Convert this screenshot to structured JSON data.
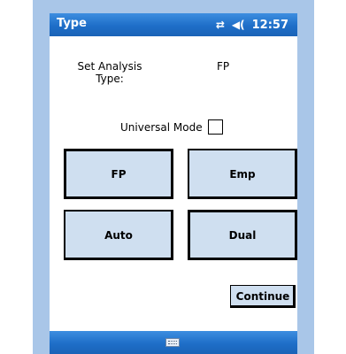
{
  "title_bar": {
    "title": "Type",
    "time": "12:57",
    "icons": [
      "connectivity-icon",
      "speaker-icon"
    ]
  },
  "form": {
    "set_label": "Set Analysis Type:",
    "type_value": "FP",
    "universal_label": "Universal Mode",
    "universal_checked": false
  },
  "buttons": {
    "fp": "FP",
    "emp": "Emp",
    "auto": "Auto",
    "dual": "Dual",
    "continue": "Continue"
  },
  "colors": {
    "titlebar": "#1e6ec8",
    "frame": "#a9c6e8",
    "button_bg": "#cfdff0"
  },
  "bottom_bar": {
    "icon": "keyboard-icon"
  }
}
